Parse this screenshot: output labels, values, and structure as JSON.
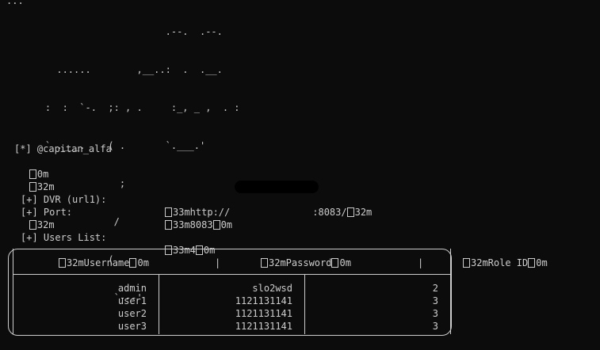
{
  "top_fragment": "...",
  "ascii_art": [
    "                         .--.  .--.",
    "      ......        ,__..:  .  .__.",
    "    :  :  `-.  ;: , .     :_, _ ,  . :",
    "    ` .___.    ( .       `.___.'",
    "                 ;",
    "                /",
    "               (",
    "                `---'"
  ],
  "lines": {
    "author": "[*] @capitan_alfa",
    "code1": "0m",
    "code2": "32m",
    "dvr_label": "[+] DVR (url1):",
    "dvr_prefix": "33mhttp://",
    "dvr_suffix": ":8083/",
    "dvr_tail": "32m",
    "port_label": "[+] Port:",
    "port_value": "33m8083",
    "port_tail": "0m",
    "code3": "32m",
    "users_label": "[+] Users List:",
    "users_value": "33m4",
    "users_tail": "0m"
  },
  "table": {
    "headers": {
      "username": "32mUsername",
      "username_tail": "0m",
      "password": "32mPassword",
      "password_tail": "0m",
      "role": "32mRole ID",
      "role_tail": "0m"
    },
    "rows": [
      {
        "user": "admin",
        "pass": "slo2wsd",
        "role": "2"
      },
      {
        "user": "user1",
        "pass": "1121131141",
        "role": "3"
      },
      {
        "user": "user2",
        "pass": "1121131141",
        "role": "3"
      },
      {
        "user": "user3",
        "pass": "1121131141",
        "role": "3"
      }
    ]
  }
}
